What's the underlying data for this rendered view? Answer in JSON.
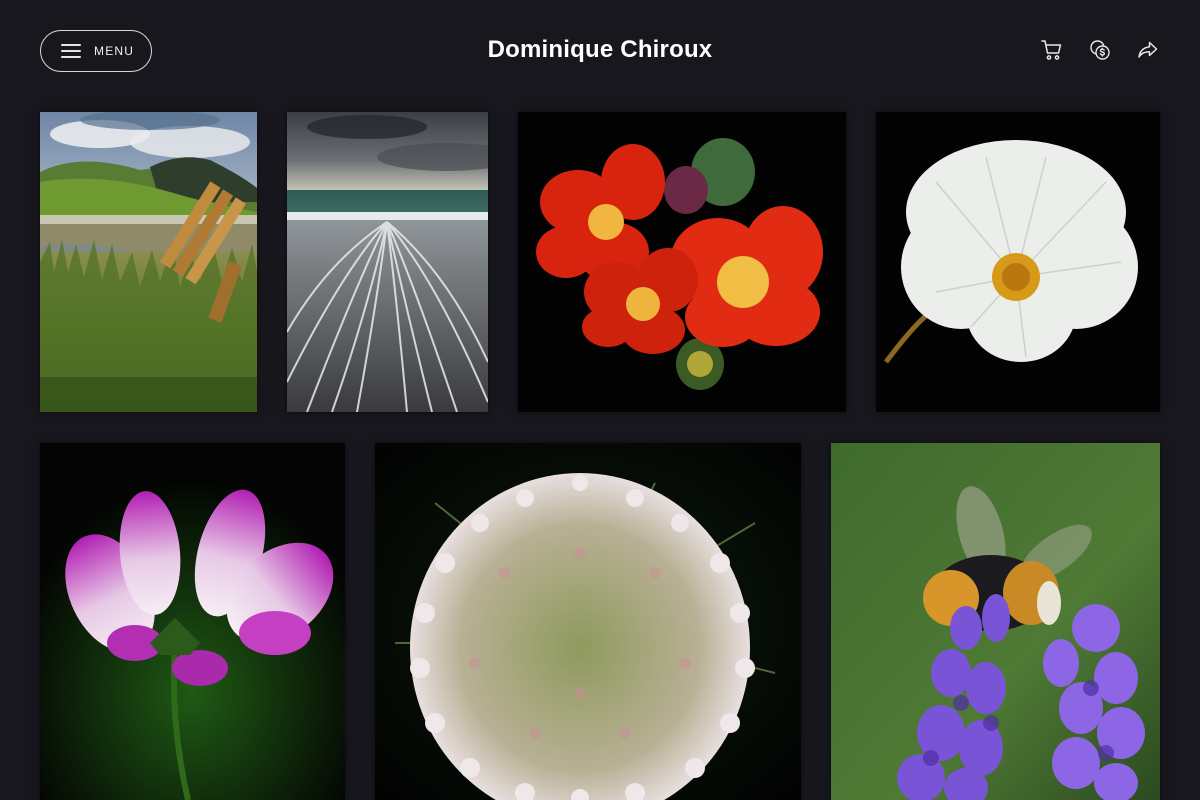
{
  "header": {
    "menu_label": "MENU",
    "site_title": "Dominique Chiroux",
    "icons": [
      "cart-icon",
      "currency-exchange-icon",
      "share-icon"
    ]
  },
  "gallery": {
    "photos": [
      {
        "name": "photo-bench-lakeside"
      },
      {
        "name": "photo-stormy-seashore"
      },
      {
        "name": "photo-red-cactus-flowers"
      },
      {
        "name": "photo-white-cosmos-flower"
      },
      {
        "name": "photo-purple-cosmos-flower"
      },
      {
        "name": "photo-queen-annes-lace"
      },
      {
        "name": "photo-bee-on-lavender"
      }
    ]
  },
  "colors": {
    "background": "#18171e",
    "text": "#ffffff",
    "border": "#d8d8dc"
  }
}
